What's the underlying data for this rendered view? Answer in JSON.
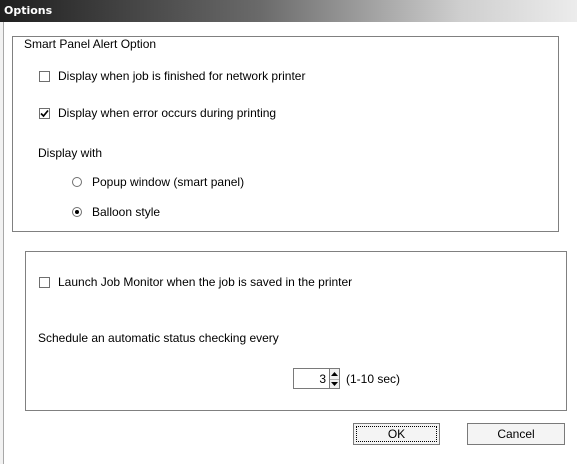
{
  "window": {
    "title": "Options"
  },
  "alert_group": {
    "legend": "Smart Panel Alert Option",
    "network_printer": {
      "label": "Display when job is finished for network printer",
      "checked": false
    },
    "error_printing": {
      "label": "Display when error occurs during printing",
      "checked": true
    },
    "display_with_label": "Display with",
    "popup": {
      "label": "Popup window (smart panel)",
      "selected": false
    },
    "balloon": {
      "label": "Balloon style",
      "selected": true
    }
  },
  "monitor_group": {
    "launch_monitor": {
      "label": "Launch Job Monitor when the job is saved in the printer",
      "checked": false
    },
    "schedule_label": "Schedule an automatic status checking every",
    "interval_value": "3",
    "interval_unit": "(1-10 sec)"
  },
  "buttons": {
    "ok": "OK",
    "cancel": "Cancel"
  }
}
